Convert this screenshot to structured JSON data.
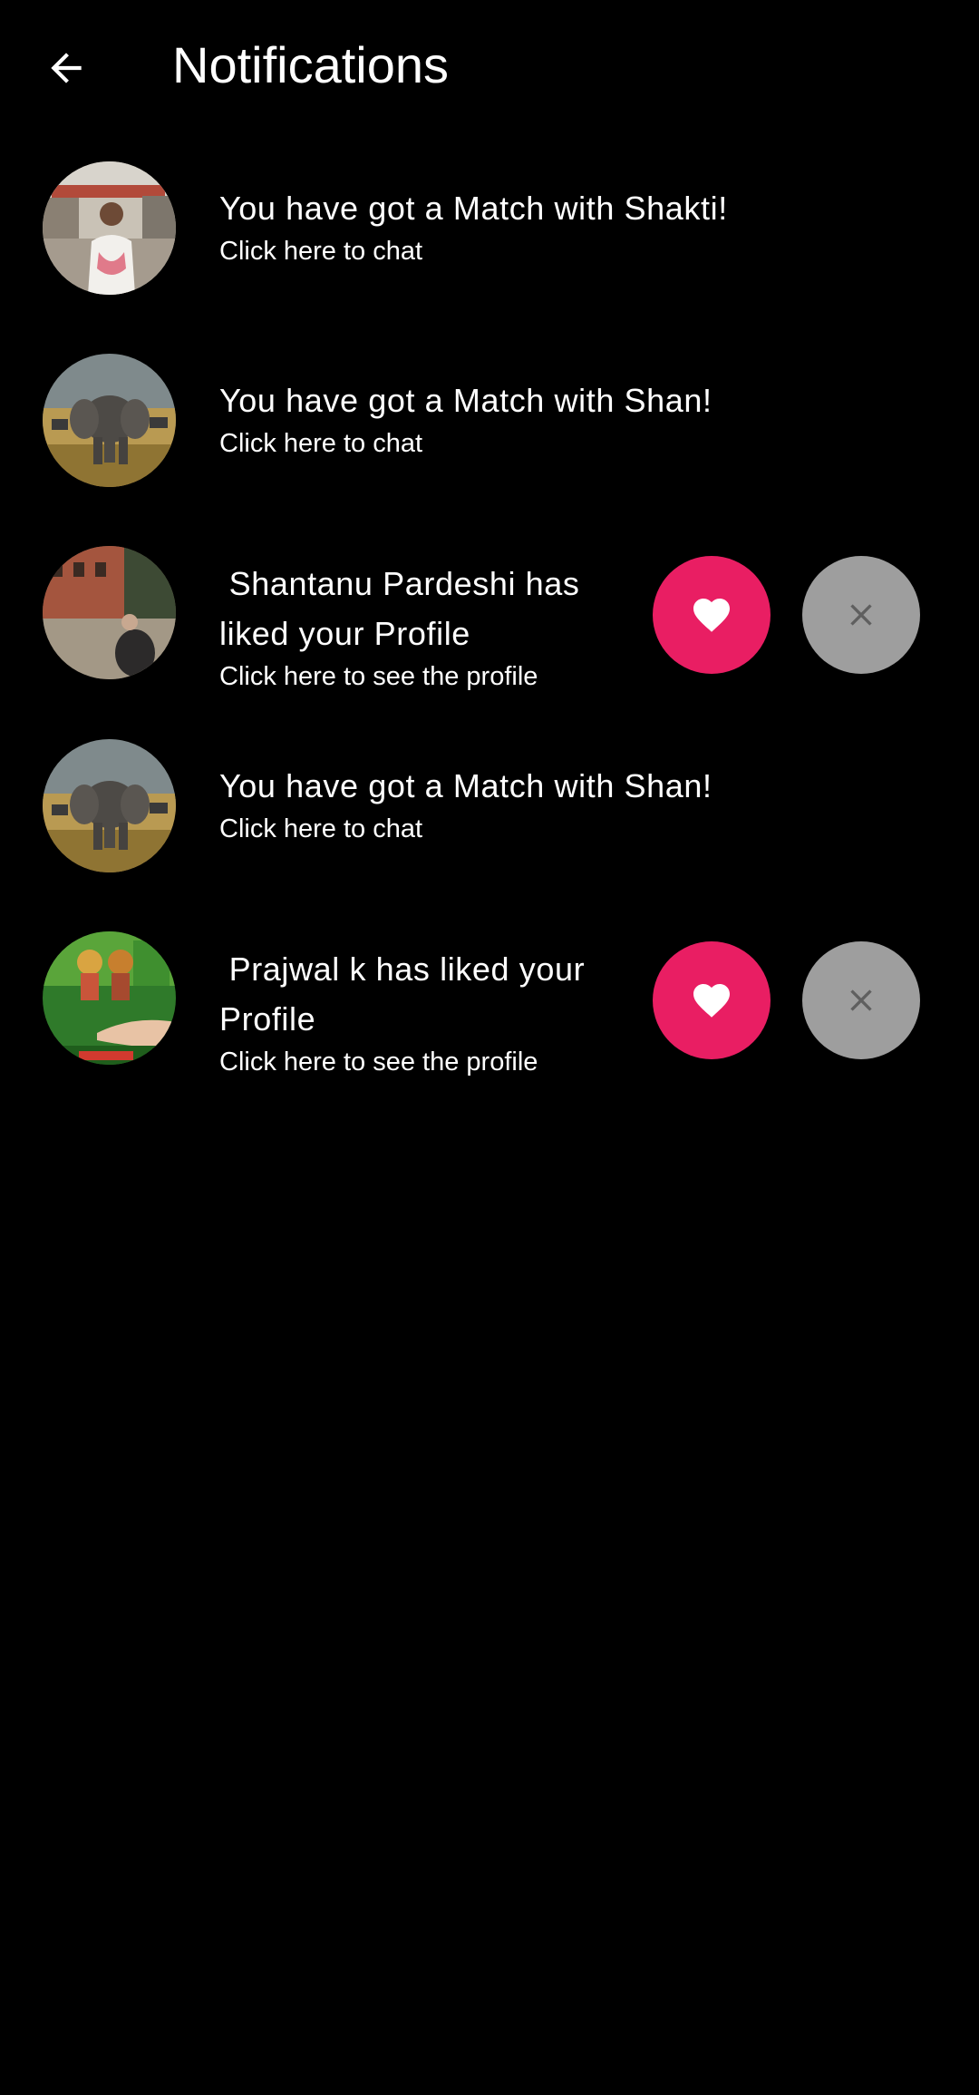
{
  "header": {
    "title": "Notifications",
    "back_icon": "arrow-left-icon"
  },
  "colors": {
    "background": "#000000",
    "text": "#ffffff",
    "like_button": "#e91e63",
    "dismiss_button": "#9e9e9e",
    "dismiss_icon": "#5f5f5f"
  },
  "notifications": [
    {
      "type": "match",
      "title": "You have got a Match with Shakti!",
      "subtitle": "Click here to chat",
      "avatar": "avatar-photo"
    },
    {
      "type": "match",
      "title": "You have got a Match with Shan!",
      "subtitle": "Click here to chat",
      "avatar": "elephant-photo"
    },
    {
      "type": "like",
      "title": " Shantanu Pardeshi has liked your Profile",
      "subtitle": "Click here to see the profile",
      "avatar": "street-photo",
      "like_icon": "heart-icon",
      "dismiss_icon": "close-icon"
    },
    {
      "type": "match",
      "title": "You have got a Match with Shan!",
      "subtitle": "Click here to chat",
      "avatar": "elephant-photo"
    },
    {
      "type": "like",
      "title": " Prajwal k has liked your Profile",
      "subtitle": "Click here to see the profile",
      "avatar": "deity-banner-photo",
      "like_icon": "heart-icon",
      "dismiss_icon": "close-icon"
    }
  ]
}
